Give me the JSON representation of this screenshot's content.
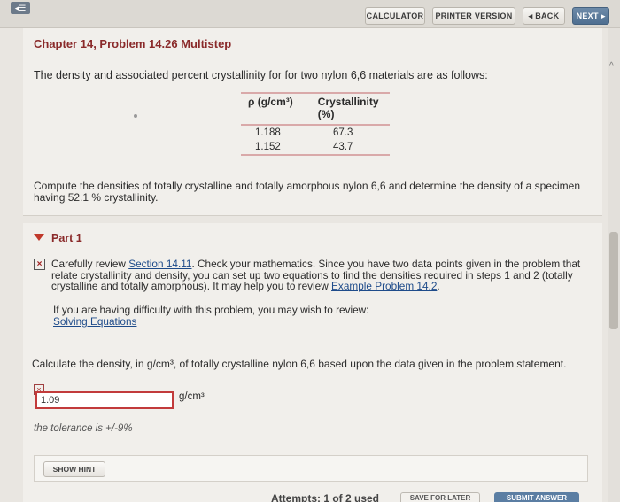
{
  "toolbar": {
    "calculator": "CALCULATOR",
    "printer": "PRINTER VERSION",
    "back": "◂ BACK",
    "next": "NEXT ▸"
  },
  "problem": {
    "title": "Chapter 14, Problem 14.26 Multistep",
    "intro": "The density and associated percent crystallinity for for two nylon 6,6 materials are as follows:",
    "table": {
      "headers": [
        "ρ (g/cm³)",
        "Crystallinity (%)"
      ],
      "rows": [
        [
          "1.188",
          "67.3"
        ],
        [
          "1.152",
          "43.7"
        ]
      ]
    },
    "compute": "Compute the densities of totally crystalline and totally amorphous nylon 6,6 and determine the density of a specimen having 52.1 % crystallinity."
  },
  "part": {
    "title": "Part 1",
    "feedback_pre": "Carefully review ",
    "feedback_link1": "Section 14.11",
    "feedback_mid": ". Check your mathematics. Since you have two data points given in the problem that relate crystallinity and density, you can set up two equations to find the densities required in steps 1 and 2 (totally crystalline and totally amorphous). It may help you to review ",
    "feedback_link2": "Example Problem 14.2",
    "feedback_post": ".",
    "review_text": "If you are having difficulty with this problem, you may wish to review:",
    "review_link": "Solving Equations",
    "question": "Calculate the density, in g/cm³, of totally crystalline nylon 6,6 based upon the data given in the problem statement.",
    "answer_value": "1.09",
    "unit": "g/cm³",
    "tolerance": "the tolerance is +/-9%",
    "show_hint": "SHOW HINT",
    "attempts": "Attempts: 1 of 2 used",
    "save_later": "SAVE FOR LATER",
    "submit": "SUBMIT ANSWER"
  },
  "colors": {
    "accent": "#8a2a2a",
    "link": "#1e4b8a",
    "error": "#c23b3b",
    "submit": "#5b7ea3"
  }
}
